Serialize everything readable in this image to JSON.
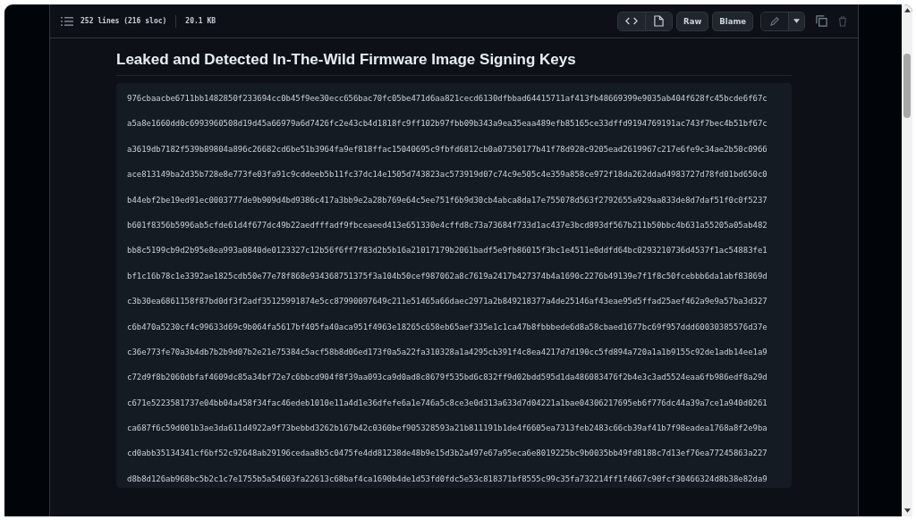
{
  "file_info": {
    "lines": "252 lines (216 sloc)",
    "size": "20.1 KB"
  },
  "toolbar": {
    "buttons": [
      "Raw",
      "Blame"
    ]
  },
  "heading": "Leaked and Detected In-The-Wild Firmware Image Signing Keys",
  "keys": [
    "976cbaacbe6711bb1482850f233694cc0b45f9ee30ecc656bac70fc05be471d6aa821cecd6130dfbbad64415711af413fb48669399e9035ab404f628fc45bcde6f67c",
    "a5a8e1660dd0c6993960508d19d45a66979a6d7426fc2e43cb4d1818fc9ff102b97fbb09b343a9ea35eaa489efb85165ce33dffd9194769191ac743f7bec4b51bf67c",
    "a3619db7182f539b89804a896c26682cd6be51b3964fa9ef818ffac15040695c9fbfd6812cb0a07350177b41f78d928c9205ead2619967c217e6fe9c34ae2b50c0966",
    "ace813149ba2d35b728e8e773fe03fa91c9cddeeb5b11fc37dc14e1505d743823ac573919d07c74c9e505c4e359a858ce972f18da262ddad4983727d78fd01bd650c0",
    "b44ebf2be19ed91ec0003777de9b909d4bd9386c417a3bb9e2a28b769e64c5ee751f6b9d30cb4abca8da17e755078d563f2792655a929aa833de8d7daf51f0c0f5237",
    "b601f8356b5996ab5cfde61d4f677dc49b22aedfffadf9fbceaeed413e651330e4cffd8c73a73684f733d1ac437e3bcd893df567b211b50bbc4b631a55205a05ab482",
    "bb8c5199cb9d2b95e8ea993a0840de0123327c12b56f6ff7f83d2b5b16a21017179b2061badf5e9fb86015f3bc1e4511e0ddfd64bc0293210736d4537f1ac54883fe1",
    "bf1c16b78c1e3392ae1825cdb50e77e78f868e934368751375f3a104b50cef987062a8c7619a2417b427374b4a1690c2276b49139e7f1f8c50fcebbb6da1abf83869d",
    "c3b30ea6861158f87bd0df3f2adf35125991874e5cc87990097649c211e51465a66daec2971a2b849218377a4de25146af43eae95d5ffad25aef462a9e9a57ba3d327",
    "c6b470a5230cf4c99633d69c9b064fa5617bf405fa40aca951f4963e18265c658eb65aef335e1c1ca47b8fbbbede6d8a58cbaed1677bc69f957ddd60030385576d37e",
    "c36e773fe70a3b4db7b2b9d07b2e21e75384c5acf58b8d06ed173f0a5a22fa310328a1a4295cb391f4c8ea4217d7d190cc5fd894a720a1a1b9155c92de1adb14ee1a9",
    "c72d9f8b2060dbfaf4609dc85a34bf72e7c6bbcd904f8f39aa093ca9d0ad8c8679f535bd6c832ff9d02bdd595d1da486083476f2b4e3c3ad5524eaa6fb986edf8a29d",
    "c671e5223581737e04bb04a458f34fac46edeb1010e11a4d1e36dfefe6a1e746a5c8ce3e0d313a633d7d04221a1bae04306217695eb6f776dc44a39a7ce1a940d0261",
    "ca687f6c59d001b3ae3da611d4922a9f73bebbd3262b167b42c0360bef905328593a21b811191b1de4f6605ea7313feb2483c66cb39af41b7f98eadea1768a8f2e9ba",
    "cd0abb35134341cf6bf52c92648ab29196cedaa8b5c0475fe4dd81238de48b9e15d3b2a497e67a95eca6e8019225bc9b0035bb49fd8188c7d13ef76ea77245863a227",
    "d8b8d126ab968bc5b2c1c7e1755b5a54603fa22613c68baf4ca1690b4de1d53fd0fdc5e53c818371bf8555c99c35fa732214ff1f4667c90fcf30466324d8b38e82da9"
  ]
}
